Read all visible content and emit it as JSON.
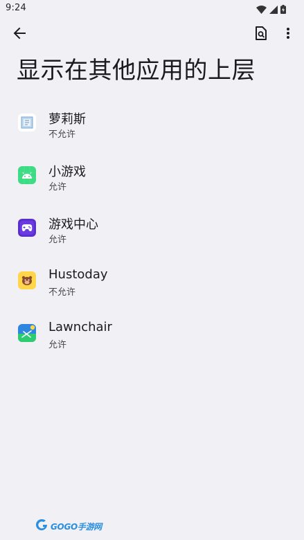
{
  "status_bar": {
    "time": "9:24",
    "icons": [
      "wifi-icon",
      "cellular-icon",
      "battery-icon"
    ]
  },
  "toolbar": {
    "back_icon": "arrow-back-icon",
    "search_icon": "search-settings-icon",
    "more_icon": "more-vert-icon"
  },
  "page": {
    "title": "显示在其他应用的上层"
  },
  "apps": [
    {
      "name": "萝莉斯",
      "status": "不允许",
      "icon": "lolis-app-icon"
    },
    {
      "name": "小游戏",
      "status": "允许",
      "icon": "android-app-icon"
    },
    {
      "name": "游戏中心",
      "status": "允许",
      "icon": "gamepad-app-icon"
    },
    {
      "name": "Hustoday",
      "status": "不允许",
      "icon": "hustoday-app-icon"
    },
    {
      "name": "Lawnchair",
      "status": "允许",
      "icon": "lawnchair-app-icon"
    }
  ],
  "watermark": {
    "text": "GOGO手游网"
  },
  "colors": {
    "background": "#f1f0f5",
    "text_primary": "#1b1b1f",
    "text_secondary": "#46464f"
  }
}
